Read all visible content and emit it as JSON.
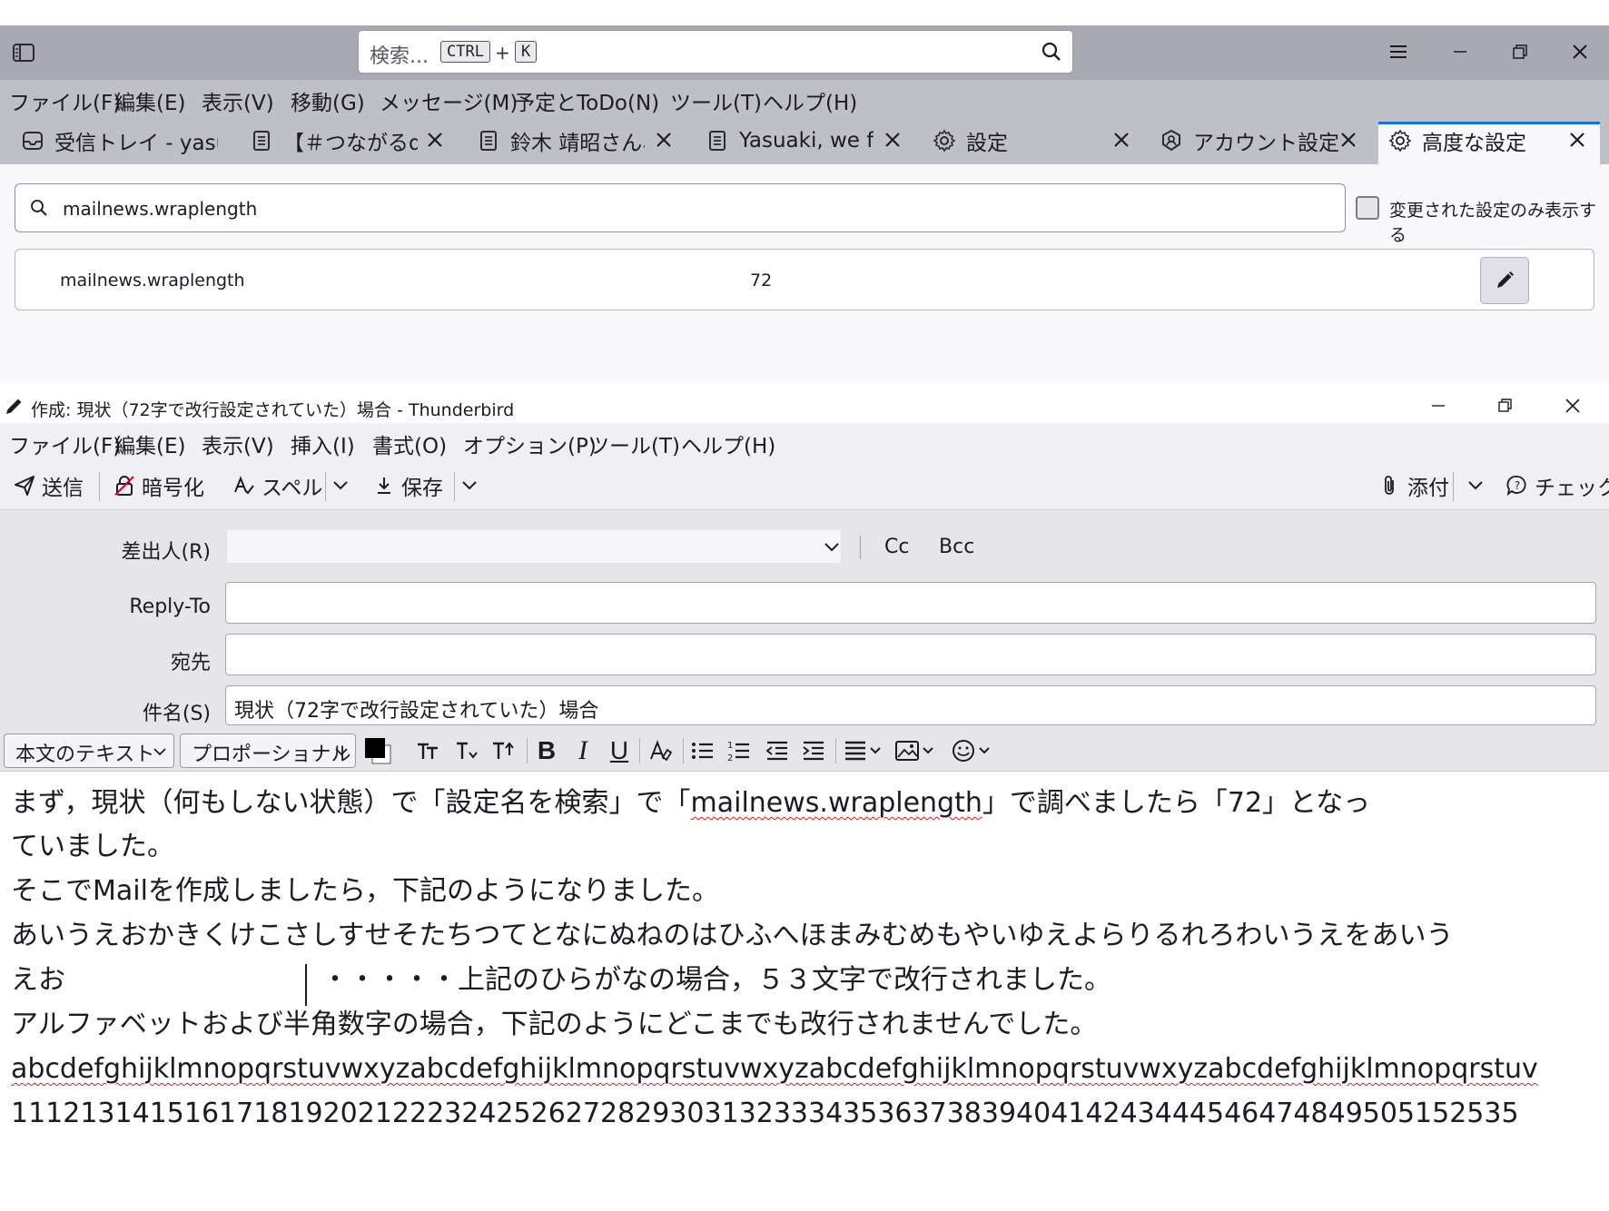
{
  "top_window": {
    "search": {
      "placeholder": "検索...",
      "key1": "CTRL",
      "plus": "+",
      "key2": "K"
    },
    "menu": [
      "ファイル(F)",
      "編集(E)",
      "表示(V)",
      "移動(G)",
      "メッセージ(M)",
      "予定とToDo(N)",
      "ツール(T)",
      "ヘルプ(H)"
    ],
    "tabs": [
      {
        "label": "受信トレイ - yasuz",
        "icon": "inbox-icon"
      },
      {
        "label": "【＃つながるdポ",
        "icon": "document-icon"
      },
      {
        "label": "鈴木 靖昭さん、",
        "icon": "document-icon"
      },
      {
        "label": "Yasuaki, we fo",
        "icon": "document-icon"
      },
      {
        "label": "設定",
        "icon": "gear-icon"
      },
      {
        "label": "アカウント設定",
        "icon": "account-icon"
      },
      {
        "label": "高度な設定",
        "icon": "gear-icon",
        "active": true
      }
    ],
    "prefs": {
      "search_value": "mailnews.wraplength",
      "modified_only_label": "変更された設定のみ表示する",
      "row": {
        "name": "mailnews.wraplength",
        "value": "72"
      }
    }
  },
  "compose": {
    "title": "作成: 現状（72字で改行設定されていた）場合 - Thunderbird",
    "menu": [
      "ファイル(F)",
      "編集(E)",
      "表示(V)",
      "挿入(I)",
      "書式(O)",
      "オプション(P)",
      "ツール(T)",
      "ヘルプ(H)"
    ],
    "toolbar": {
      "send": "送信",
      "encrypt": "暗号化",
      "spell": "スペル",
      "save": "保存",
      "attach": "添付",
      "check": "チェック"
    },
    "headers": {
      "from_label": "差出人(R)",
      "cc": "Cc",
      "bcc": "Bcc",
      "reply_to_label": "Reply-To",
      "to_label": "宛先",
      "subject_label": "件名(S)",
      "subject_value": "現状（72字で改行設定されていた）場合"
    },
    "format": {
      "paragraph": "本文のテキスト",
      "font": "プロポーショナル"
    },
    "body": {
      "line1_a": "まず，現状（何もしない状態）で「設定名を検索」で「",
      "line1_b": "mailnews.wraplength",
      "line1_c": "」で調べましたら「72」となっ",
      "line2": "ていました。",
      "line3": "そこでMailを作成しましたら，下記のようになりました。",
      "line4": "あいうえおかきくけこさしすせそたちつてとなにぬねのはひふへほまみむめもやいゆえよらりるれろわいうえをあいう",
      "line5_a": "えお",
      "line5_b": "・・・・・上記のひらがなの場合，５３文字で改行されました。",
      "line6": "アルファベットおよび半角数字の場合，下記のようにどこまでも改行されませんでした。",
      "line7": "abcdefghijklmnopqrstuvwxyzabcdefghijklmnopqrstuvwxyzabcdefghijklmnopqrstuvwxyzabcdefghijklmnopqrstuv",
      "line8": "111213141516171819202122232425262728293031323334353637383940414243444546474849505152535"
    }
  }
}
